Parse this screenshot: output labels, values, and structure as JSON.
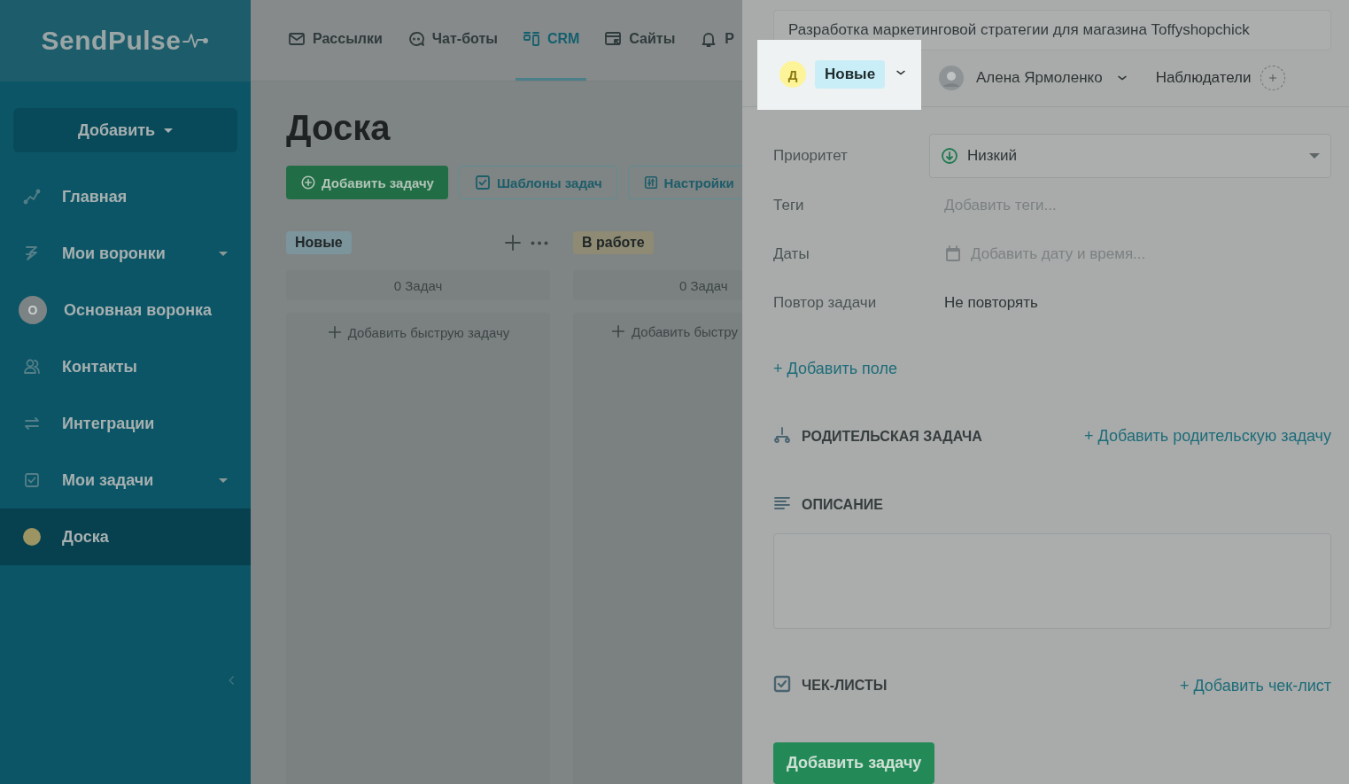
{
  "sidebar": {
    "logo": "SendPulse",
    "add_button": "Добавить",
    "items": [
      {
        "label": "Главная",
        "kind": "icon",
        "caret": false,
        "selected": false
      },
      {
        "label": "Мои воронки",
        "kind": "icon",
        "caret": true,
        "selected": false
      },
      {
        "label": "Основная воронка",
        "kind": "avatar",
        "letter": "О",
        "caret": false,
        "selected": false
      },
      {
        "label": "Контакты",
        "kind": "icon",
        "caret": false,
        "selected": false
      },
      {
        "label": "Интеграции",
        "kind": "icon",
        "caret": false,
        "selected": false
      },
      {
        "label": "Мои задачи",
        "kind": "icon",
        "caret": true,
        "selected": false
      },
      {
        "label": "Доска",
        "kind": "dot",
        "color": "#9c9462",
        "caret": false,
        "selected": true
      }
    ]
  },
  "top_nav": [
    {
      "label": "Рассылки",
      "selected": false
    },
    {
      "label": "Чат-боты",
      "selected": false
    },
    {
      "label": "CRM",
      "selected": true
    },
    {
      "label": "Сайты",
      "selected": false
    },
    {
      "label": "Р",
      "selected": false
    }
  ],
  "page_title": "Доска",
  "toolbar": [
    {
      "label": "Добавить задачу",
      "kind": "primary"
    },
    {
      "label": "Шаблоны задач",
      "kind": "outline"
    },
    {
      "label": "Настройки",
      "kind": "outline"
    }
  ],
  "columns": [
    {
      "title": "Новые",
      "color": "#7c949b",
      "actions": true,
      "count": "0 Задач",
      "quick_add": "Добавить быструю задачу"
    },
    {
      "title": "В работе",
      "color": "#8e8a74",
      "actions": false,
      "count": "0 Задач",
      "quick_add": "Добавить быстру"
    }
  ],
  "drawer": {
    "title_field": {
      "value": "Разработка маркетинговой стратегии для магазина Toffyshopchick"
    },
    "status": {
      "letter": "Д",
      "label": "Новые"
    },
    "assignee": "Алена Ярмоленко",
    "watchers": "Наблюдатели",
    "fields": [
      {
        "label": "Приоритет",
        "kind": "select",
        "value": "Низкий"
      },
      {
        "label": "Теги",
        "kind": "tags",
        "placeholder": "Добавить теги..."
      },
      {
        "label": "Даты",
        "kind": "date",
        "placeholder": "Добавить дату и время..."
      },
      {
        "label": "Повтор задачи",
        "kind": "text",
        "value": "Не повторять"
      }
    ],
    "add_field": "+ Добавить поле",
    "parent": {
      "title": "РОДИТЕЛЬСКАЯ ЗАДАЧА",
      "action": "+ Добавить родительскую задачу"
    },
    "description": {
      "title": "ОПИСАНИЕ"
    },
    "checklists": {
      "title": "ЧЕК-ЛИСТЫ",
      "action": "+ Добавить чек-лист"
    },
    "submit": "Добавить задачу"
  }
}
